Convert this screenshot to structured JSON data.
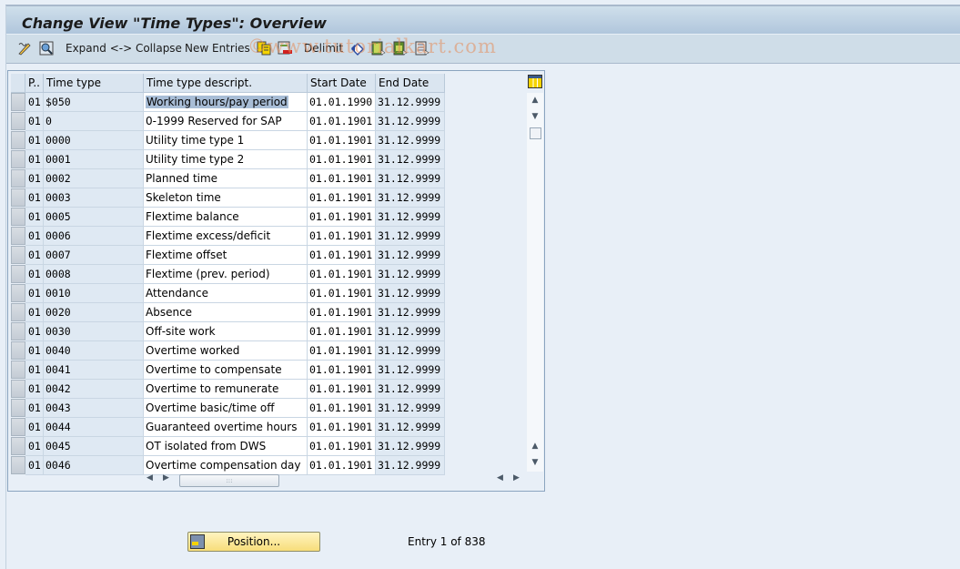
{
  "window": {
    "title": "Change View \"Time Types\": Overview"
  },
  "toolbar": {
    "expand_collapse_label": "Expand <-> Collapse",
    "new_entries_label": "New Entries",
    "delimit_label": "Delimit",
    "watermark": "©www.tutorialkart.com"
  },
  "table": {
    "columns": [
      "P..",
      "Time type",
      "Time type descript.",
      "Start Date",
      "End Date"
    ],
    "rows": [
      {
        "p": "01",
        "type": "$050",
        "desc": "Working hours/pay period",
        "start": "01.01.1990",
        "end": "31.12.9999",
        "selected": true
      },
      {
        "p": "01",
        "type": "0",
        "desc": "0-1999 Reserved for SAP",
        "start": "01.01.1901",
        "end": "31.12.9999"
      },
      {
        "p": "01",
        "type": "0000",
        "desc": "Utility time type 1",
        "start": "01.01.1901",
        "end": "31.12.9999"
      },
      {
        "p": "01",
        "type": "0001",
        "desc": "Utility time type 2",
        "start": "01.01.1901",
        "end": "31.12.9999"
      },
      {
        "p": "01",
        "type": "0002",
        "desc": "Planned time",
        "start": "01.01.1901",
        "end": "31.12.9999"
      },
      {
        "p": "01",
        "type": "0003",
        "desc": "Skeleton time",
        "start": "01.01.1901",
        "end": "31.12.9999"
      },
      {
        "p": "01",
        "type": "0005",
        "desc": "Flextime balance",
        "start": "01.01.1901",
        "end": "31.12.9999"
      },
      {
        "p": "01",
        "type": "0006",
        "desc": "Flextime excess/deficit",
        "start": "01.01.1901",
        "end": "31.12.9999"
      },
      {
        "p": "01",
        "type": "0007",
        "desc": "Flextime offset",
        "start": "01.01.1901",
        "end": "31.12.9999"
      },
      {
        "p": "01",
        "type": "0008",
        "desc": "Flextime (prev. period)",
        "start": "01.01.1901",
        "end": "31.12.9999"
      },
      {
        "p": "01",
        "type": "0010",
        "desc": "Attendance",
        "start": "01.01.1901",
        "end": "31.12.9999"
      },
      {
        "p": "01",
        "type": "0020",
        "desc": "Absence",
        "start": "01.01.1901",
        "end": "31.12.9999"
      },
      {
        "p": "01",
        "type": "0030",
        "desc": "Off-site work",
        "start": "01.01.1901",
        "end": "31.12.9999"
      },
      {
        "p": "01",
        "type": "0040",
        "desc": "Overtime worked",
        "start": "01.01.1901",
        "end": "31.12.9999"
      },
      {
        "p": "01",
        "type": "0041",
        "desc": "Overtime to compensate",
        "start": "01.01.1901",
        "end": "31.12.9999"
      },
      {
        "p": "01",
        "type": "0042",
        "desc": "Overtime to remunerate",
        "start": "01.01.1901",
        "end": "31.12.9999"
      },
      {
        "p": "01",
        "type": "0043",
        "desc": "Overtime basic/time off",
        "start": "01.01.1901",
        "end": "31.12.9999"
      },
      {
        "p": "01",
        "type": "0044",
        "desc": "Guaranteed overtime hours",
        "start": "01.01.1901",
        "end": "31.12.9999"
      },
      {
        "p": "01",
        "type": "0045",
        "desc": "OT isolated from DWS",
        "start": "01.01.1901",
        "end": "31.12.9999"
      },
      {
        "p": "01",
        "type": "0046",
        "desc": "Overtime compensation day",
        "start": "01.01.1901",
        "end": "31.12.9999"
      }
    ]
  },
  "footer": {
    "position_button_label": "Position...",
    "entry_text": "Entry 1 of 838"
  }
}
